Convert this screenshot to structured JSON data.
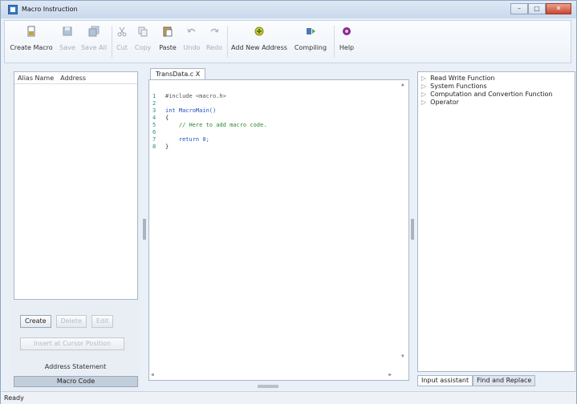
{
  "window": {
    "title": "Macro Instruction",
    "controls": [
      "minimize",
      "maximize",
      "close"
    ]
  },
  "toolbar": [
    {
      "label": "Create Macro",
      "icon": "create-macro-icon",
      "enabled": true
    },
    {
      "label": "Save",
      "icon": "save-icon",
      "enabled": false
    },
    {
      "label": "Save All",
      "icon": "save-all-icon",
      "enabled": false
    },
    {
      "label": "Cut",
      "icon": "cut-icon",
      "enabled": false
    },
    {
      "label": "Copy",
      "icon": "copy-icon",
      "enabled": false
    },
    {
      "label": "Paste",
      "icon": "paste-icon",
      "enabled": true
    },
    {
      "label": "Undo",
      "icon": "undo-icon",
      "enabled": false
    },
    {
      "label": "Redo",
      "icon": "redo-icon",
      "enabled": false
    },
    {
      "label": "Add New Address",
      "icon": "add-address-icon",
      "enabled": true
    },
    {
      "label": "Compiling",
      "icon": "compile-icon",
      "enabled": true
    },
    {
      "label": "Help",
      "icon": "help-icon",
      "enabled": true
    }
  ],
  "left_panel": {
    "columns": [
      "Alias Name",
      "Address"
    ],
    "buttons": {
      "create": "Create",
      "delete": "Delete",
      "edit": "Edit"
    },
    "insert_button": "Insert at Cursor Position",
    "section_label": "Address Statement",
    "tab": "Macro Code"
  },
  "editor": {
    "tab": "TransData.c",
    "tab_close": "X",
    "lines": [
      {
        "n": "1",
        "text": "#include <macro.h>",
        "style": "pp"
      },
      {
        "n": "2",
        "text": "",
        "style": ""
      },
      {
        "n": "3",
        "text": "int MacroMain()",
        "style": "kw"
      },
      {
        "n": "4",
        "text": "{",
        "style": ""
      },
      {
        "n": "5",
        "text": "    // Here to add macro code.",
        "style": "cm"
      },
      {
        "n": "6",
        "text": "",
        "style": ""
      },
      {
        "n": "7",
        "text": "    return 0;",
        "style": ""
      },
      {
        "n": "8",
        "text": "}",
        "style": ""
      }
    ]
  },
  "right_panel": {
    "tree": [
      "Read Write Function",
      "System Functions",
      "Computation and Convertion Function",
      "Operator"
    ],
    "tabs": [
      "Input assistant",
      "Find and Replace"
    ]
  },
  "status": "Ready"
}
